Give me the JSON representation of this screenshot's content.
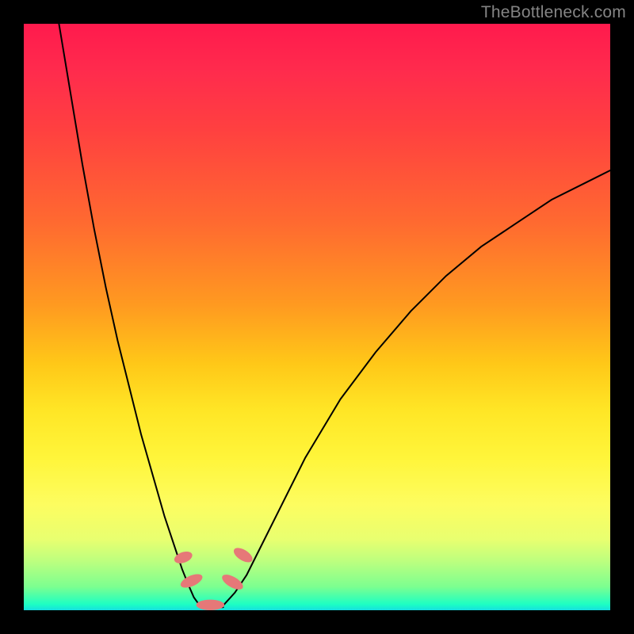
{
  "watermark": "TheBottleneck.com",
  "chart_data": {
    "type": "line",
    "title": "",
    "xlabel": "",
    "ylabel": "",
    "xlim": [
      0,
      100
    ],
    "ylim": [
      0,
      100
    ],
    "background_gradient": {
      "top": "#ff1a4d",
      "upper_mid": "#ff9a20",
      "mid": "#fff53a",
      "lower": "#7cff90",
      "bottom": "#15dfe0"
    },
    "series": [
      {
        "name": "left-branch",
        "stroke": "#000000",
        "x": [
          6,
          8,
          10,
          12,
          14,
          16,
          18,
          20,
          22,
          24,
          26,
          27,
          28,
          29,
          30
        ],
        "y": [
          100,
          88,
          76,
          65,
          55,
          46,
          38,
          30,
          23,
          16,
          10,
          7,
          4.5,
          2.2,
          0.8
        ]
      },
      {
        "name": "right-branch",
        "stroke": "#000000",
        "x": [
          34,
          36,
          38,
          40,
          44,
          48,
          54,
          60,
          66,
          72,
          78,
          84,
          90,
          96,
          100
        ],
        "y": [
          0.8,
          3,
          6,
          10,
          18,
          26,
          36,
          44,
          51,
          57,
          62,
          66,
          70,
          73,
          75
        ]
      },
      {
        "name": "floor-baseline",
        "stroke": "#000000",
        "x": [
          30,
          34
        ],
        "y": [
          0.5,
          0.5
        ]
      }
    ],
    "markers": [
      {
        "name": "cluster-left-upper",
        "cx": 27.2,
        "cy": 9.0,
        "rx": 0.9,
        "ry": 1.6,
        "rot": 70,
        "fill": "#e67878"
      },
      {
        "name": "cluster-left-lower",
        "cx": 28.6,
        "cy": 5.0,
        "rx": 0.9,
        "ry": 2.0,
        "rot": 66,
        "fill": "#e67878"
      },
      {
        "name": "trough-blob",
        "cx": 31.8,
        "cy": 0.9,
        "rx": 2.4,
        "ry": 0.9,
        "rot": 0,
        "fill": "#e67878"
      },
      {
        "name": "cluster-right-lower",
        "cx": 35.6,
        "cy": 4.8,
        "rx": 0.9,
        "ry": 2.0,
        "rot": -60,
        "fill": "#e67878"
      },
      {
        "name": "cluster-right-upper",
        "cx": 37.4,
        "cy": 9.4,
        "rx": 0.9,
        "ry": 1.8,
        "rot": -58,
        "fill": "#e67878"
      }
    ]
  }
}
